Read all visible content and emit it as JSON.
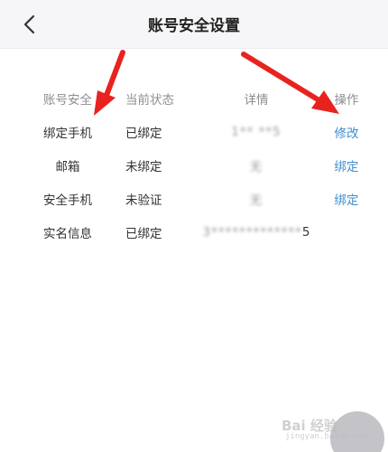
{
  "header": {
    "title": "账号安全设置",
    "back_icon": "chevron-left-icon"
  },
  "table": {
    "columns": [
      "账号安全",
      "当前状态",
      "详情",
      "操作"
    ],
    "rows": [
      {
        "item": "绑定手机",
        "status": "已绑定",
        "detail": "1**  **5   ",
        "detail_tail": "",
        "action": "修改"
      },
      {
        "item": "邮箱",
        "status": "未绑定",
        "detail": "无",
        "detail_tail": "",
        "action": "绑定"
      },
      {
        "item": "安全手机",
        "status": "未验证",
        "detail": "无",
        "detail_tail": "",
        "action": "绑定"
      },
      {
        "item": "实名信息",
        "status": "已绑定",
        "detail": "3*************",
        "detail_tail": "5",
        "action": ""
      }
    ]
  },
  "annotations": {
    "arrow_color": "#e8231f"
  },
  "watermark": {
    "text": "Bai 经验",
    "sub": "jingyan.baidu.com"
  },
  "colors": {
    "link": "#3f8fd0",
    "header_bg": "#f6f6f8"
  }
}
